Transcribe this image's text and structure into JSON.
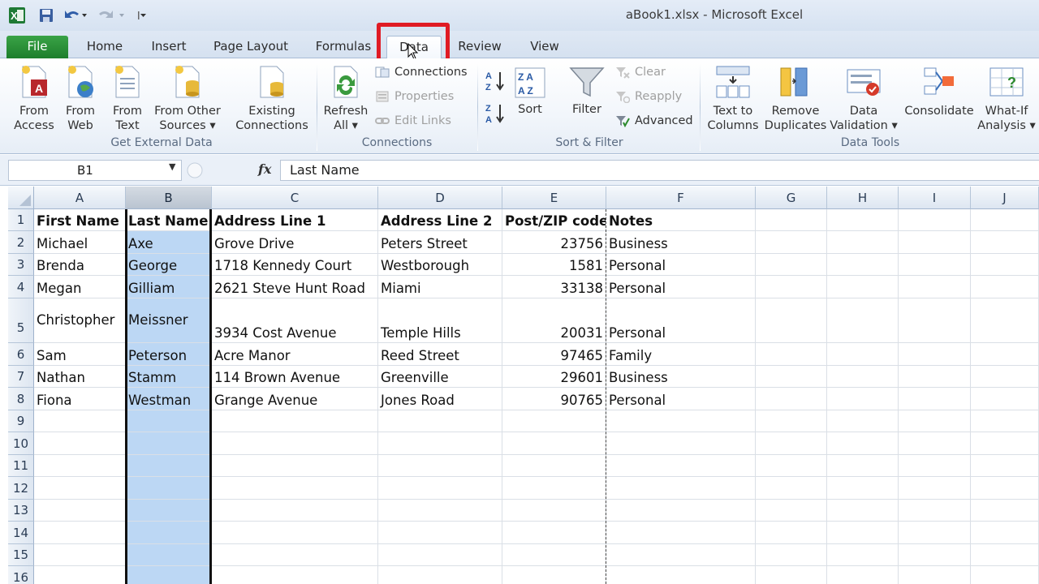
{
  "window": {
    "title": "aBook1.xlsx  -  Microsoft Excel"
  },
  "tabs": [
    {
      "key": "file",
      "label": "File"
    },
    {
      "key": "home",
      "label": "Home"
    },
    {
      "key": "insert",
      "label": "Insert"
    },
    {
      "key": "page_layout",
      "label": "Page Layout"
    },
    {
      "key": "formulas",
      "label": "Formulas"
    },
    {
      "key": "data",
      "label": "Data"
    },
    {
      "key": "review",
      "label": "Review"
    },
    {
      "key": "view",
      "label": "View"
    }
  ],
  "ribbon": {
    "get_external_data": {
      "label": "Get External Data",
      "from_access": [
        "From",
        "Access"
      ],
      "from_web": [
        "From",
        "Web"
      ],
      "from_text": [
        "From",
        "Text"
      ],
      "from_other": [
        "From Other",
        "Sources ▾"
      ],
      "existing": [
        "Existing",
        "Connections"
      ]
    },
    "connections": {
      "label": "Connections",
      "refresh": [
        "Refresh",
        "All ▾"
      ],
      "connections": "Connections",
      "properties": "Properties",
      "edit_links": "Edit Links"
    },
    "sort_filter": {
      "label": "Sort & Filter",
      "sort": "Sort",
      "filter": "Filter",
      "clear": "Clear",
      "reapply": "Reapply",
      "advanced": "Advanced"
    },
    "data_tools": {
      "label": "Data Tools",
      "text_to_columns": [
        "Text to",
        "Columns"
      ],
      "remove_duplicates": [
        "Remove",
        "Duplicates"
      ],
      "data_validation": [
        "Data",
        "Validation ▾"
      ],
      "consolidate": "Consolidate",
      "what_if": [
        "What-If",
        "Analysis ▾"
      ]
    }
  },
  "formula_bar": {
    "name_box": "B1",
    "fx": "fx",
    "value": "Last Name"
  },
  "columns": [
    "A",
    "B",
    "C",
    "D",
    "E",
    "F",
    "G",
    "H",
    "I",
    "J"
  ],
  "rows": [
    "1",
    "2",
    "3",
    "4",
    "5",
    "6",
    "7",
    "8",
    "9",
    "10",
    "11",
    "12",
    "13",
    "14",
    "15",
    "16"
  ],
  "headers": [
    "First Name",
    "Last Name",
    "Address Line 1",
    "Address Line 2",
    "Post/ZIP code",
    "Notes"
  ],
  "data": [
    [
      "Michael",
      "Axe",
      "Grove Drive",
      "Peters Street",
      "23756",
      "Business"
    ],
    [
      "Brenda",
      "George",
      "1718 Kennedy Court",
      "Westborough",
      "1581",
      "Personal"
    ],
    [
      "Megan",
      "Gilliam",
      "2621 Steve Hunt Road",
      "Miami",
      "33138",
      "Personal"
    ],
    [
      "Christopher",
      "Meissner",
      "3934 Cost Avenue",
      "Temple Hills",
      "20031",
      "Personal"
    ],
    [
      "Sam",
      "Peterson",
      "Acre Manor",
      "Reed Street",
      "97465",
      "Family"
    ],
    [
      "Nathan",
      "Stamm",
      "114 Brown Avenue",
      "Greenville",
      "29601",
      "Business"
    ],
    [
      "Fiona",
      "Westman",
      "Grange Avenue",
      "Jones Road",
      "90765",
      "Personal"
    ]
  ]
}
